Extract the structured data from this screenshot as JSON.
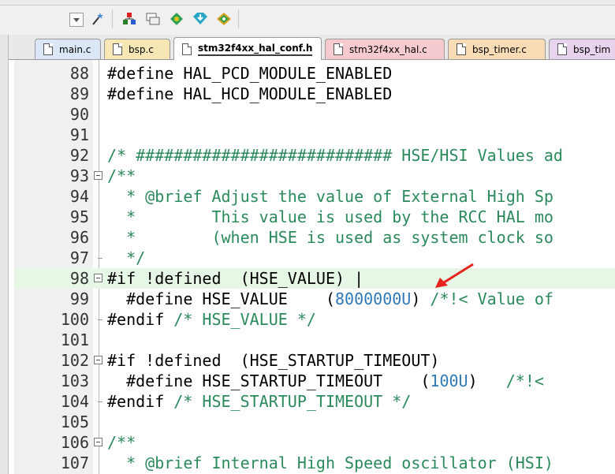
{
  "tabs": [
    {
      "label": "main.c",
      "color": "#dbe7f7"
    },
    {
      "label": "bsp.c",
      "color": "#f6e7b5"
    },
    {
      "label": "stm32f4xx_hal_conf.h",
      "color": "#ffffff",
      "active": true
    },
    {
      "label": "stm32f4xx_hal.c",
      "color": "#f6cbd0"
    },
    {
      "label": "bsp_timer.c",
      "color": "#f7dcb6"
    },
    {
      "label": "bsp_tim",
      "color": "#e8d3ee"
    }
  ],
  "toolbar_icons": [
    "dropdown-arrow-icon",
    "magic-wand-icon",
    "target-build-icon",
    "window-layout-icon",
    "diamond-settings-icon",
    "heart-download-icon",
    "stacked-diamond-icon"
  ],
  "code_lines": [
    {
      "num": "88",
      "text": "#define HAL_PCD_MODULE_ENABLED"
    },
    {
      "num": "89",
      "text": "#define HAL_HCD_MODULE_ENABLED"
    },
    {
      "num": "90",
      "text": ""
    },
    {
      "num": "91",
      "text": ""
    },
    {
      "num": "92",
      "text": "/* ########################### HSE/HSI Values ad"
    },
    {
      "num": "93",
      "text": "/**",
      "fold": true
    },
    {
      "num": "94",
      "text": "  * @brief Adjust the value of External High Sp"
    },
    {
      "num": "95",
      "text": "  *        This value is used by the RCC HAL mo"
    },
    {
      "num": "96",
      "text": "  *        (when HSE is used as system clock so"
    },
    {
      "num": "97",
      "text": "  */"
    },
    {
      "num": "98",
      "text": "#if !defined  (HSE_VALUE) |",
      "fold": true,
      "highlight": true
    },
    {
      "num": "99",
      "text": "  #define HSE_VALUE    (8000000U) /*!< Value of"
    },
    {
      "num": "100",
      "text": "#endif /* HSE_VALUE */"
    },
    {
      "num": "101",
      "text": ""
    },
    {
      "num": "102",
      "text": "#if !defined  (HSE_STARTUP_TIMEOUT)",
      "fold": true
    },
    {
      "num": "103",
      "text": "  #define HSE_STARTUP_TIMEOUT    (100U)   /*!<"
    },
    {
      "num": "104",
      "text": "#endif /* HSE_STARTUP_TIMEOUT */"
    },
    {
      "num": "105",
      "text": ""
    },
    {
      "num": "106",
      "text": "/**",
      "fold": true
    },
    {
      "num": "107",
      "text": "  * @brief Internal High Speed oscillator (HSI)"
    }
  ],
  "annotation": {
    "arrow_color": "#e8231e"
  }
}
